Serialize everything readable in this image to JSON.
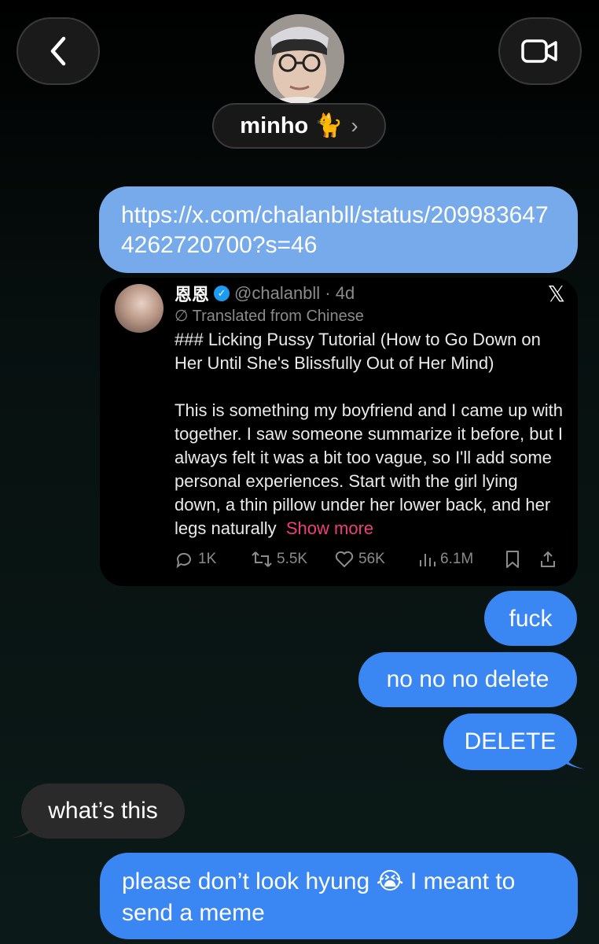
{
  "header": {
    "contact_name": "minho",
    "contact_emoji": "🐈",
    "chevron": "›",
    "back_icon": "chevron-left-icon",
    "video_icon": "video-camera-icon"
  },
  "messages": {
    "link_url": "https://x.com/chalanbll/status/2099836474262720700?s=46",
    "fuck": "fuck",
    "nono": "no no no delete",
    "delete": "DELETE",
    "whats_this": "what’s this",
    "last": "please don’t look hyung 😭 I meant to send a meme"
  },
  "tweet": {
    "display_name": "恩恩",
    "handle_time": "@chalanbll · 4d",
    "x_logo": "𝕏",
    "translated": "Translated from Chinese",
    "title": "### Licking Pussy Tutorial (How to Go Down on Her Until She's Blissfully Out of Her Mind)",
    "body": "This is something my boyfriend and I came up with together. I saw someone summarize it before, but I always felt it was a bit too vague, so I'll add some personal experiences. Start with the girl lying down, a thin pillow under her lower back, and her legs naturally",
    "show_more": "Show more",
    "replies": "1K",
    "reposts": "5.5K",
    "likes": "56K",
    "views": "6.1M"
  },
  "colors": {
    "outgoing_bubble": "#3a86f2",
    "link_bubble": "#76aaea",
    "incoming_bubble": "#2a2a2a",
    "show_more": "#ee3f7a"
  }
}
